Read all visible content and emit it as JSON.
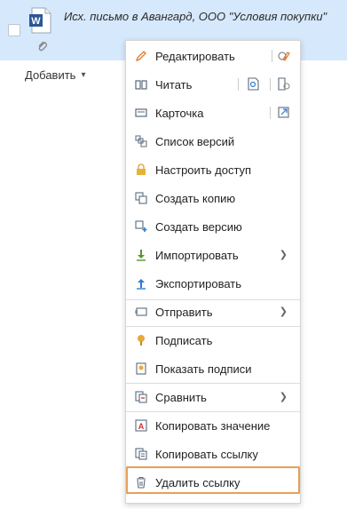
{
  "document": {
    "title": "Исх. письмо в Авангард, ООО \"Условия покупки\"",
    "icon": "word-icon",
    "attachment_icon": "paperclip-icon"
  },
  "toolbar": {
    "add_label": "Добавить"
  },
  "menu": {
    "edit": "Редактировать",
    "read": "Читать",
    "card": "Карточка",
    "versions": "Список версий",
    "access": "Настроить доступ",
    "copy": "Создать копию",
    "new_version": "Создать версию",
    "import": "Импортировать",
    "export": "Экспортировать",
    "send": "Отправить",
    "sign": "Подписать",
    "show_signatures": "Показать подписи",
    "compare": "Сравнить",
    "copy_value": "Копировать значение",
    "copy_link": "Копировать ссылку",
    "delete_link": "Удалить ссылку"
  },
  "colors": {
    "row_selected": "#d6e8fb",
    "highlight_border": "#e8a055",
    "word_blue": "#2b5797"
  }
}
